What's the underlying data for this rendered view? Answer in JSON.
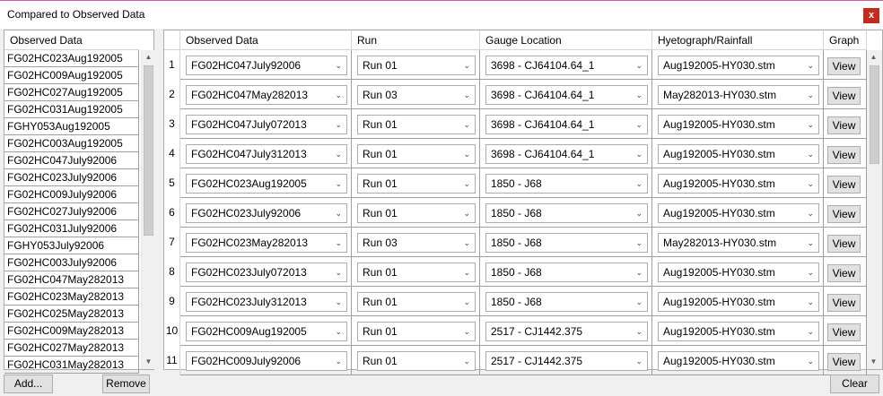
{
  "window": {
    "title": "Compared to Observed Data",
    "close_label": "x"
  },
  "left_list": {
    "header": "Observed Data",
    "items": [
      "FG02HC023Aug192005",
      "FG02HC009Aug192005",
      "FG02HC027Aug192005",
      "FG02HC031Aug192005",
      "FGHY053Aug192005",
      "FG02HC003Aug192005",
      "FG02HC047July92006",
      "FG02HC023July92006",
      "FG02HC009July92006",
      "FG02HC027July92006",
      "FG02HC031July92006",
      "FGHY053July92006",
      "FG02HC003July92006",
      "FG02HC047May282013",
      "FG02HC023May282013",
      "FG02HC025May282013",
      "FG02HC009May282013",
      "FG02HC027May282013",
      "FG02HC031May282013"
    ]
  },
  "grid": {
    "headers": [
      "Observed Data",
      "Run",
      "Gauge Location",
      "Hyetograph/Rainfall",
      "Graph"
    ],
    "rows": [
      {
        "num": "1",
        "observed": "FG02HC047July92006",
        "run": "Run 01",
        "gauge": "3698 - CJ64104.64_1",
        "hyeto": "Aug192005-HY030.stm",
        "graph": "View"
      },
      {
        "num": "2",
        "observed": "FG02HC047May282013",
        "run": "Run 03",
        "gauge": "3698 - CJ64104.64_1",
        "hyeto": "May282013-HY030.stm",
        "graph": "View"
      },
      {
        "num": "3",
        "observed": "FG02HC047July072013",
        "run": "Run 01",
        "gauge": "3698 - CJ64104.64_1",
        "hyeto": "Aug192005-HY030.stm",
        "graph": "View"
      },
      {
        "num": "4",
        "observed": "FG02HC047July312013",
        "run": "Run 01",
        "gauge": "3698 - CJ64104.64_1",
        "hyeto": "Aug192005-HY030.stm",
        "graph": "View"
      },
      {
        "num": "5",
        "observed": "FG02HC023Aug192005",
        "run": "Run 01",
        "gauge": "1850 - J68",
        "hyeto": "Aug192005-HY030.stm",
        "graph": "View"
      },
      {
        "num": "6",
        "observed": "FG02HC023July92006",
        "run": "Run 01",
        "gauge": "1850 - J68",
        "hyeto": "Aug192005-HY030.stm",
        "graph": "View"
      },
      {
        "num": "7",
        "observed": "FG02HC023May282013",
        "run": "Run 03",
        "gauge": "1850 - J68",
        "hyeto": "May282013-HY030.stm",
        "graph": "View"
      },
      {
        "num": "8",
        "observed": "FG02HC023July072013",
        "run": "Run 01",
        "gauge": "1850 - J68",
        "hyeto": "Aug192005-HY030.stm",
        "graph": "View"
      },
      {
        "num": "9",
        "observed": "FG02HC023July312013",
        "run": "Run 01",
        "gauge": "1850 - J68",
        "hyeto": "Aug192005-HY030.stm",
        "graph": "View"
      },
      {
        "num": "10",
        "observed": "FG02HC009Aug192005",
        "run": "Run 01",
        "gauge": "2517 - CJ1442.375",
        "hyeto": "Aug192005-HY030.stm",
        "graph": "View"
      },
      {
        "num": "11",
        "observed": "FG02HC009July92006",
        "run": "Run 01",
        "gauge": "2517 - CJ1442.375",
        "hyeto": "Aug192005-HY030.stm",
        "graph": "View"
      }
    ]
  },
  "buttons": {
    "add": "Add...",
    "remove": "Remove",
    "clear": "Clear"
  },
  "icons": {
    "dropdown": "chevron-down-icon",
    "scroll_up": "arrow-up-icon",
    "scroll_down": "arrow-down-icon"
  },
  "colors": {
    "close_button": "#c42b1c",
    "accent_border": "#d35aa8"
  }
}
